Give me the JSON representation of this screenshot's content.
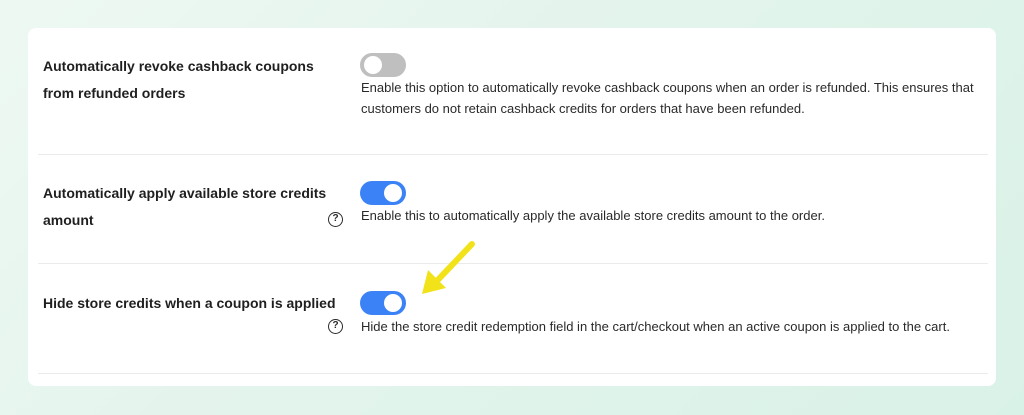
{
  "settings": [
    {
      "label": "Automatically revoke cashback coupons from refunded orders",
      "enabled": false,
      "has_help": false,
      "description": "Enable this option to automatically revoke cashback coupons when an order is refunded. This ensures that customers do not retain cashback credits for orders that have been refunded."
    },
    {
      "label": "Automatically apply available store credits amount",
      "enabled": true,
      "has_help": true,
      "help_icon": "?",
      "description": "Enable this to automatically apply the available store credits amount to the order."
    },
    {
      "label": "Hide store credits when a coupon is applied",
      "enabled": true,
      "has_help": true,
      "help_icon": "?",
      "description": "Hide the store credit redemption field in the cart/checkout when an active coupon is applied to the cart."
    }
  ],
  "colors": {
    "toggle_on": "#3b82f6",
    "toggle_off": "#bfbfbf",
    "annotation_arrow": "#f2e21a"
  },
  "annotation": {
    "icon": "arrow-pointer-icon"
  }
}
